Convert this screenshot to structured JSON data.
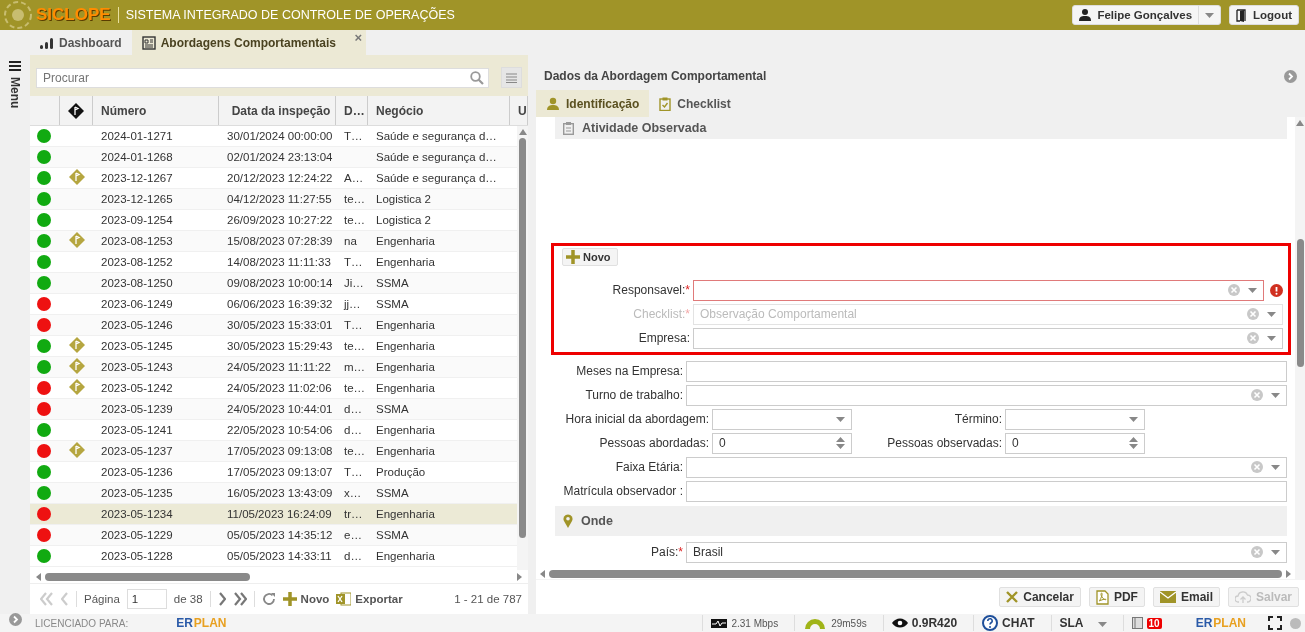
{
  "header": {
    "logo": "SICLOPE",
    "title": "SISTEMA INTEGRADO DE CONTROLE DE OPERAÇÕES",
    "user": "Felipe Gonçalves",
    "logout": "Logout"
  },
  "sidebar": {
    "label": "Menu"
  },
  "tabs": [
    {
      "label": "Dashboard",
      "kind": "chart",
      "selected": false
    },
    {
      "label": "Abordagens Comportamentais",
      "kind": "form",
      "selected": true,
      "close": "×"
    }
  ],
  "search": {
    "placeholder": "Procurar"
  },
  "table": {
    "columns": [
      "Número",
      "Data da inspeção",
      "D…",
      "Negócio",
      "U"
    ],
    "rows": [
      {
        "color": "#11aa11",
        "flagged": false,
        "number": "2024-01-1271",
        "date": "30/01/2024 00:00:00",
        "column_5": "T…",
        "business": "Saúde e segurança d…",
        "selected": false
      },
      {
        "color": "#11aa11",
        "flagged": false,
        "number": "2024-01-1268",
        "date": "02/01/2024 23:13:04",
        "column_5": "",
        "business": "Saúde e segurança d…",
        "selected": false
      },
      {
        "color": "#11aa11",
        "flagged": true,
        "number": "2023-12-1267",
        "date": "20/12/2023 12:24:22",
        "column_5": "A…",
        "business": "Saúde e segurança d…",
        "selected": false
      },
      {
        "color": "#11aa11",
        "flagged": false,
        "number": "2023-12-1265",
        "date": "04/12/2023 11:27:55",
        "column_5": "te…",
        "business": "Logistica 2",
        "selected": false
      },
      {
        "color": "#11aa11",
        "flagged": false,
        "number": "2023-09-1254",
        "date": "26/09/2023 10:27:22",
        "column_5": "te…",
        "business": "Logistica 2",
        "selected": false
      },
      {
        "color": "#11aa11",
        "flagged": true,
        "number": "2023-08-1253",
        "date": "15/08/2023 07:28:39",
        "column_5": "na",
        "business": "Engenharia",
        "selected": false
      },
      {
        "color": "#11aa11",
        "flagged": false,
        "number": "2023-08-1252",
        "date": "14/08/2023 11:11:33",
        "column_5": "T…",
        "business": "Engenharia",
        "selected": false
      },
      {
        "color": "#11aa11",
        "flagged": false,
        "number": "2023-08-1250",
        "date": "09/08/2023 10:00:14",
        "column_5": "Ji…",
        "business": "SSMA",
        "selected": false
      },
      {
        "color": "#ee1111",
        "flagged": false,
        "number": "2023-06-1249",
        "date": "06/06/2023 16:39:32",
        "column_5": "jj…",
        "business": "SSMA",
        "selected": false
      },
      {
        "color": "#ee1111",
        "flagged": false,
        "number": "2023-05-1246",
        "date": "30/05/2023 15:33:01",
        "column_5": "T…",
        "business": "Engenharia",
        "selected": false
      },
      {
        "color": "#11aa11",
        "flagged": true,
        "number": "2023-05-1245",
        "date": "30/05/2023 15:29:43",
        "column_5": "te…",
        "business": "Engenharia",
        "selected": false
      },
      {
        "color": "#11aa11",
        "flagged": true,
        "number": "2023-05-1243",
        "date": "24/05/2023 11:11:22",
        "column_5": "m…",
        "business": "Engenharia",
        "selected": false
      },
      {
        "color": "#ee1111",
        "flagged": true,
        "number": "2023-05-1242",
        "date": "24/05/2023 11:02:06",
        "column_5": "te…",
        "business": "Engenharia",
        "selected": false
      },
      {
        "color": "#ee1111",
        "flagged": false,
        "number": "2023-05-1239",
        "date": "24/05/2023 10:44:01",
        "column_5": "d…",
        "business": "SSMA",
        "selected": false
      },
      {
        "color": "#11aa11",
        "flagged": false,
        "number": "2023-05-1241",
        "date": "22/05/2023 10:54:06",
        "column_5": "d…",
        "business": "Engenharia",
        "selected": false
      },
      {
        "color": "#ee1111",
        "flagged": true,
        "number": "2023-05-1237",
        "date": "17/05/2023 09:13:08",
        "column_5": "te…",
        "business": "Engenharia",
        "selected": false
      },
      {
        "color": "#11aa11",
        "flagged": false,
        "number": "2023-05-1236",
        "date": "17/05/2023 09:13:07",
        "column_5": "T…",
        "business": "Produção",
        "selected": false
      },
      {
        "color": "#11aa11",
        "flagged": false,
        "number": "2023-05-1235",
        "date": "16/05/2023 13:43:09",
        "column_5": "x…",
        "business": "SSMA",
        "selected": false
      },
      {
        "color": "#ee1111",
        "flagged": false,
        "number": "2023-05-1234",
        "date": "11/05/2023 16:24:09",
        "column_5": "tr…",
        "business": "Engenharia",
        "selected": true
      },
      {
        "color": "#ee1111",
        "flagged": false,
        "number": "2023-05-1229",
        "date": "05/05/2023 14:35:12",
        "column_5": "e…",
        "business": "SSMA",
        "selected": false
      },
      {
        "color": "#11aa11",
        "flagged": false,
        "number": "2023-05-1228",
        "date": "05/05/2023 14:33:11",
        "column_5": "d…",
        "business": "Engenharia",
        "selected": false
      }
    ]
  },
  "pager": {
    "page_label": "Página",
    "page": "1",
    "of": "de 38",
    "new": "Novo",
    "export": "Exportar",
    "range": "1 - 21 de 787"
  },
  "detail": {
    "title": "Dados da Abordagem Comportamental",
    "tabs": [
      {
        "label": "Identificação",
        "kind": "person",
        "selected": true
      },
      {
        "label": "Checklist",
        "kind": "check",
        "selected": false
      }
    ],
    "section": "Atividade Observada",
    "highlight": {
      "button": "Novo",
      "rows": [
        {
          "fields": [
            {
              "label": "Responsavel:",
              "mark": "*",
              "kind": "select",
              "error": true,
              "disabled": false
            }
          ]
        },
        {
          "fields": [
            {
              "label": "Checklist:",
              "mark": "*",
              "kind": "select",
              "value": "Observação Comportamental",
              "error": false,
              "disabled": true
            }
          ]
        },
        {
          "fields": [
            {
              "label": "Empresa:",
              "kind": "select",
              "error": false,
              "disabled": false
            }
          ]
        }
      ]
    },
    "rows": [
      {
        "fields": [
          {
            "label": "Meses na Empresa:",
            "kind": "text",
            "error": false,
            "disabled": false
          }
        ]
      },
      {
        "fields": [
          {
            "label": "Turno de trabalho:",
            "kind": "select",
            "error": false,
            "disabled": false
          }
        ]
      },
      {
        "fields": [
          {
            "label": "Hora inicial da abordagem:",
            "kind": "time",
            "error": false,
            "disabled": false
          },
          {
            "label": "Término:",
            "kind": "time",
            "error": false,
            "disabled": false
          }
        ]
      },
      {
        "fields": [
          {
            "label": "Pessoas abordadas:",
            "kind": "number",
            "value": "0",
            "error": false,
            "disabled": false
          },
          {
            "label": "Pessoas observadas:",
            "kind": "number",
            "value": "0",
            "error": false,
            "disabled": false
          }
        ]
      },
      {
        "fields": [
          {
            "label": "Faixa Etária:",
            "kind": "select",
            "error": false,
            "disabled": false
          }
        ]
      },
      {
        "fields": [
          {
            "label": "Matrícula observador :",
            "kind": "text",
            "error": false,
            "disabled": false
          }
        ]
      }
    ],
    "section_2": "Onde",
    "rows_2": [
      {
        "fields": [
          {
            "label": "País:",
            "mark": "*",
            "kind": "select",
            "value": "Brasil",
            "error": false,
            "disabled": false
          }
        ]
      }
    ],
    "buttons": [
      {
        "label": "Cancelar",
        "kind": "cancel",
        "disabled": false
      },
      {
        "label": "PDF",
        "kind": "pdf",
        "disabled": false
      },
      {
        "label": "Email",
        "kind": "email",
        "disabled": false
      },
      {
        "label": "Salvar",
        "kind": "save",
        "disabled": true
      }
    ]
  },
  "status_bar": {
    "license": "LICENCIADO PARA:",
    "brand_left": {
      "part_1": "ER",
      "part_2": "PLAN"
    },
    "brand_right": {
      "part_1": "ER",
      "part_2": "PLAN"
    },
    "speed": "2.31 Mbps",
    "timer": "29m59s",
    "version": "0.9R420",
    "chat": "CHAT",
    "sla": "SLA",
    "badge": "10"
  }
}
